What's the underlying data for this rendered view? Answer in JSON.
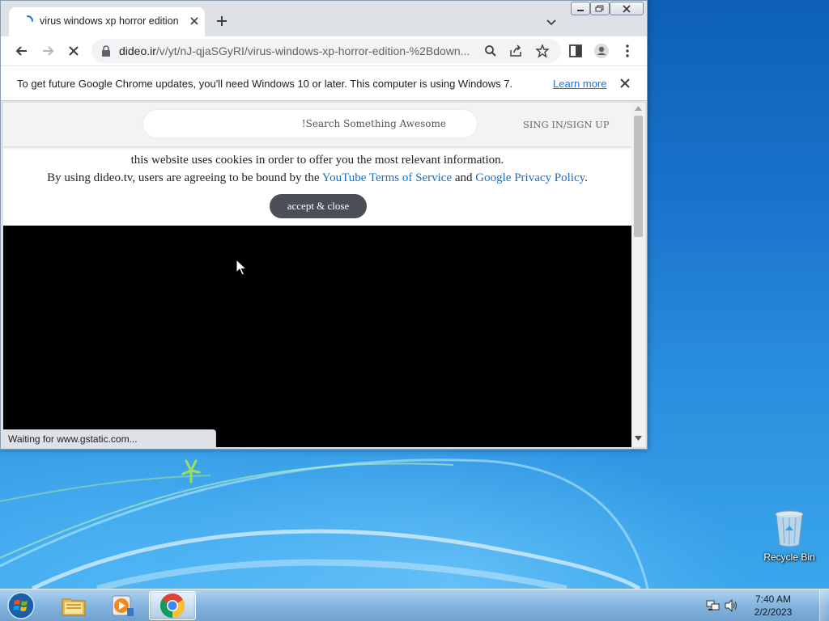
{
  "browser": {
    "tab_title": "virus windows xp horror edition",
    "url_host": "dideo.ir",
    "url_path": "/v/yt/nJ-qjaSGyRI/virus-windows-xp-horror-edition-%2Bdown...",
    "status_text": "Waiting for www.gstatic.com..."
  },
  "infobar": {
    "message": "To get future Google Chrome updates, you'll need Windows 10 or later. This computer is using Windows 7.",
    "link_label": "Learn more"
  },
  "site": {
    "search_placeholder": "!Search Something Awesome",
    "signin_label": "SING IN/SIGN UP",
    "cookie_line1": "this website uses cookies in order to offer you the most relevant information.",
    "cookie_line2_prefix": "By using dideo.tv, users are agreeing to be bound by the",
    "cookie_link_youtube": "YouTube Terms of Service",
    "cookie_and": "and",
    "cookie_link_google": "Google Privacy Policy",
    "cookie_period": ".",
    "accept_label": "accept & close"
  },
  "desktop": {
    "recycle_bin_label": "Recycle Bin"
  },
  "taskbar": {
    "time": "7:40 AM",
    "date": "2/2/2023",
    "items": [
      {
        "name": "windows-explorer",
        "icon": "folder-icon"
      },
      {
        "name": "media-player",
        "icon": "media-player-icon"
      },
      {
        "name": "google-chrome",
        "icon": "chrome-icon",
        "active": true
      }
    ]
  },
  "colors": {
    "accent_link": "#1a73e8",
    "site_link": "#1a6ec0",
    "accept_button": "#4a4f57"
  }
}
